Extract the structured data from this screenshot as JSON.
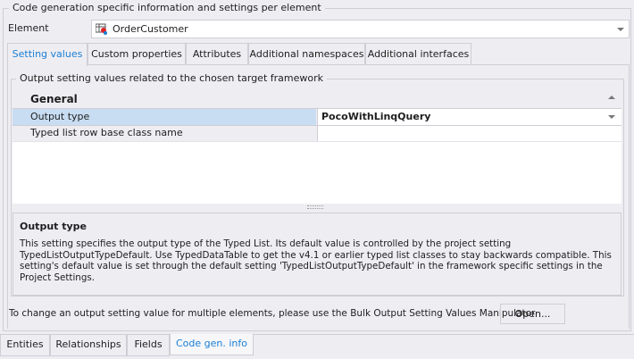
{
  "group_title": "Code generation specific information and settings per element",
  "element": {
    "label": "Element",
    "value": "OrderCustomer",
    "icon": "typed-list-icon"
  },
  "tabs": [
    {
      "label": "Setting values",
      "active": true
    },
    {
      "label": "Custom properties"
    },
    {
      "label": "Attributes"
    },
    {
      "label": "Additional namespaces"
    },
    {
      "label": "Additional interfaces"
    }
  ],
  "inner_group_title": "Output setting values related to the chosen target framework",
  "grid": {
    "category": "General",
    "rows": [
      {
        "name": "Output type",
        "value": "PocoWithLinqQuery",
        "selected": true
      },
      {
        "name": "Typed list row base class name",
        "value": ""
      }
    ]
  },
  "description": {
    "title": "Output type",
    "text": "This setting specifies the output type of the Typed List. Its default value is controlled by the project setting TypedListOutputTypeDefault. Use TypedDataTable to get the v4.1 or earlier typed list classes to stay backwards compatible. This setting's default value is set through the default setting 'TypedListOutputTypeDefault' in the framework specific settings in the Project Settings."
  },
  "bulk": {
    "text": "To change an output setting value for multiple elements, please use the Bulk Output Setting Values Manipulator",
    "button": "Open..."
  },
  "bottom_tabs": [
    {
      "label": "Entities"
    },
    {
      "label": "Relationships"
    },
    {
      "label": "Fields"
    },
    {
      "label": "Code gen. info",
      "active": true
    }
  ],
  "colors": {
    "accent": "#1a7fd4",
    "selection": "#c8ddf2",
    "background": "#eeedf2"
  }
}
